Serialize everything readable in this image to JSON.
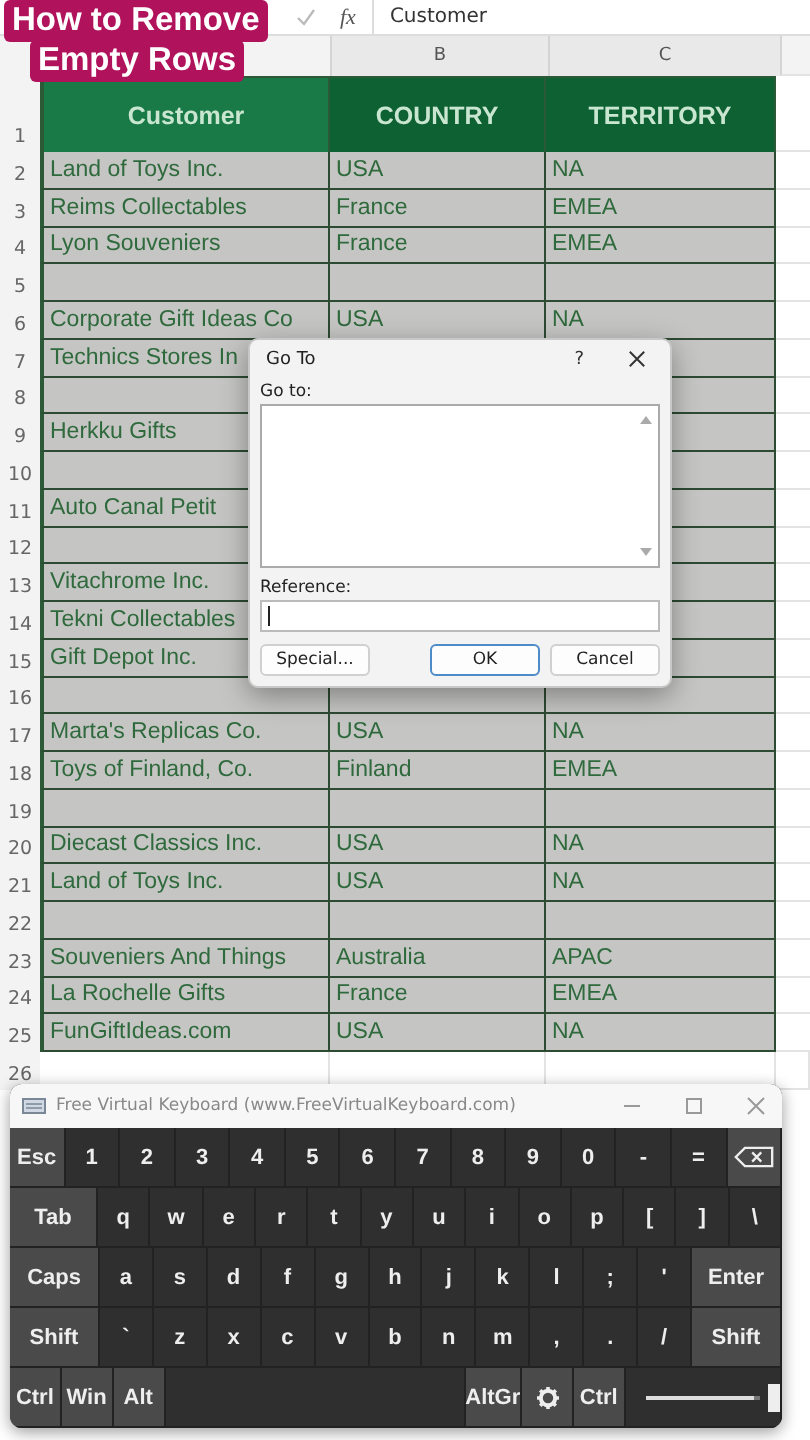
{
  "title_overlay": [
    "How to Remove",
    "Empty Rows"
  ],
  "formula_bar": {
    "function_label": "fx",
    "value": "Customer"
  },
  "column_headers": [
    "B",
    "C"
  ],
  "table": {
    "columns": [
      "Customer",
      "COUNTRY",
      "TERRITORY"
    ],
    "header_row": "1",
    "rows": [
      {
        "row": "2",
        "cells": [
          "Land of Toys Inc.",
          "USA",
          "NA"
        ]
      },
      {
        "row": "3",
        "cells": [
          "Reims Collectables",
          "France",
          "EMEA"
        ]
      },
      {
        "row": "4",
        "cells": [
          "Lyon Souveniers",
          "France",
          "EMEA"
        ]
      },
      {
        "row": "5",
        "cells": []
      },
      {
        "row": "6",
        "cells": [
          "Corporate Gift Ideas Co",
          "USA",
          "NA"
        ]
      },
      {
        "row": "7",
        "cells": [
          "Technics Stores In"
        ]
      },
      {
        "row": "8",
        "cells": []
      },
      {
        "row": "9",
        "cells": [
          "Herkku Gifts"
        ]
      },
      {
        "row": "10",
        "cells": []
      },
      {
        "row": "11",
        "cells": [
          "Auto Canal Petit"
        ]
      },
      {
        "row": "12",
        "cells": []
      },
      {
        "row": "13",
        "cells": [
          "Vitachrome Inc."
        ]
      },
      {
        "row": "14",
        "cells": [
          "Tekni Collectables"
        ]
      },
      {
        "row": "15",
        "cells": [
          "Gift Depot Inc."
        ]
      },
      {
        "row": "16",
        "cells": []
      },
      {
        "row": "17",
        "cells": [
          "Marta's Replicas Co.",
          "USA",
          "NA"
        ]
      },
      {
        "row": "18",
        "cells": [
          "Toys of Finland, Co.",
          "Finland",
          "EMEA"
        ]
      },
      {
        "row": "19",
        "cells": []
      },
      {
        "row": "20",
        "cells": [
          "Diecast Classics Inc.",
          "USA",
          "NA"
        ]
      },
      {
        "row": "21",
        "cells": [
          "Land of Toys Inc.",
          "USA",
          "NA"
        ]
      },
      {
        "row": "22",
        "cells": []
      },
      {
        "row": "23",
        "cells": [
          "Souveniers And Things",
          "Australia",
          "APAC"
        ]
      },
      {
        "row": "24",
        "cells": [
          "La Rochelle Gifts",
          "France",
          "EMEA"
        ]
      },
      {
        "row": "25",
        "cells": [
          "FunGiftIdeas.com",
          "USA",
          "NA"
        ]
      }
    ]
  },
  "extra_rows": [
    "26"
  ],
  "dialog": {
    "title": "Go To",
    "help": "?",
    "list_label": "Go to:",
    "reference_label": "Reference:",
    "buttons": [
      {
        "label": "Special...",
        "default": false
      },
      {
        "label": "OK",
        "default": true
      },
      {
        "label": "Cancel",
        "default": false
      }
    ]
  },
  "keyboard": {
    "title": "Free Virtual Keyboard (www.FreeVirtualKeyboard.com)",
    "key_rows": [
      {
        "keys": [
          {
            "kind": "mod",
            "label": "Esc"
          },
          {
            "kind": "char",
            "label": "1"
          },
          {
            "kind": "char",
            "label": "2"
          },
          {
            "kind": "char",
            "label": "3"
          },
          {
            "kind": "char",
            "label": "4"
          },
          {
            "kind": "char",
            "label": "5"
          },
          {
            "kind": "char",
            "label": "6"
          },
          {
            "kind": "char",
            "label": "7"
          },
          {
            "kind": "char",
            "label": "8"
          },
          {
            "kind": "char",
            "label": "9"
          },
          {
            "kind": "char",
            "label": "0"
          },
          {
            "kind": "char",
            "label": "-"
          },
          {
            "kind": "char",
            "label": "="
          },
          {
            "kind": "backspace"
          }
        ]
      },
      {
        "keys": [
          {
            "kind": "wide",
            "label": "Tab"
          },
          {
            "kind": "char",
            "label": "q"
          },
          {
            "kind": "char",
            "label": "w"
          },
          {
            "kind": "char",
            "label": "e"
          },
          {
            "kind": "char",
            "label": "r"
          },
          {
            "kind": "char",
            "label": "t"
          },
          {
            "kind": "char",
            "label": "y"
          },
          {
            "kind": "char",
            "label": "u"
          },
          {
            "kind": "char",
            "label": "i"
          },
          {
            "kind": "char",
            "label": "o"
          },
          {
            "kind": "char",
            "label": "p"
          },
          {
            "kind": "char",
            "label": "["
          },
          {
            "kind": "char",
            "label": "]"
          },
          {
            "kind": "char",
            "label": "\\"
          }
        ]
      },
      {
        "keys": [
          {
            "kind": "wide",
            "label": "Caps"
          },
          {
            "kind": "char",
            "label": "a"
          },
          {
            "kind": "char",
            "label": "s"
          },
          {
            "kind": "char",
            "label": "d"
          },
          {
            "kind": "char",
            "label": "f"
          },
          {
            "kind": "char",
            "label": "g"
          },
          {
            "kind": "char",
            "label": "h"
          },
          {
            "kind": "char",
            "label": "j"
          },
          {
            "kind": "char",
            "label": "k"
          },
          {
            "kind": "char",
            "label": "l"
          },
          {
            "kind": "char",
            "label": ";"
          },
          {
            "kind": "char",
            "label": "'"
          },
          {
            "kind": "wide",
            "label": "Enter"
          }
        ]
      },
      {
        "keys": [
          {
            "kind": "wide",
            "label": "Shift"
          },
          {
            "kind": "char",
            "label": "`"
          },
          {
            "kind": "char",
            "label": "z"
          },
          {
            "kind": "char",
            "label": "x"
          },
          {
            "kind": "char",
            "label": "c"
          },
          {
            "kind": "char",
            "label": "v"
          },
          {
            "kind": "char",
            "label": "b"
          },
          {
            "kind": "char",
            "label": "n"
          },
          {
            "kind": "char",
            "label": "m"
          },
          {
            "kind": "char",
            "label": ","
          },
          {
            "kind": "char",
            "label": "."
          },
          {
            "kind": "char",
            "label": "/"
          },
          {
            "kind": "wide",
            "label": "Shift"
          }
        ]
      },
      {
        "keys": [
          {
            "kind": "mod",
            "label": "Ctrl"
          },
          {
            "kind": "mod",
            "label": "Win"
          },
          {
            "kind": "mod",
            "label": "Alt"
          },
          {
            "kind": "space"
          },
          {
            "kind": "mod",
            "label": "AltGr"
          },
          {
            "kind": "settings"
          },
          {
            "kind": "mod",
            "label": "Ctrl"
          },
          {
            "kind": "slider",
            "level": 0.95
          }
        ]
      }
    ]
  }
}
